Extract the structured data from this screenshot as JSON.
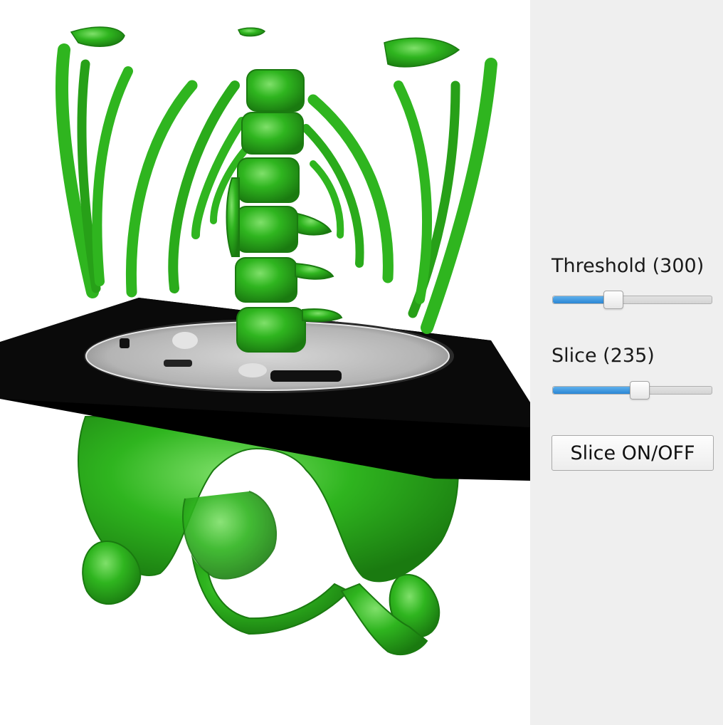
{
  "viewport": {
    "bone_color": "#2fb51f",
    "bone_shadow": "#1c7d12",
    "slice_plane_color": "#000000",
    "scan_color": "#c8c8c8"
  },
  "controls": {
    "threshold": {
      "label": "Threshold (300)",
      "value": 300,
      "fraction": 0.36
    },
    "slice": {
      "label": "Slice (235)",
      "value": 235,
      "fraction": 0.55
    },
    "toggle_button": {
      "label": "Slice ON/OFF"
    }
  },
  "colors": {
    "panel_background": "#efefef",
    "slider_fill": "#2a86d4"
  }
}
